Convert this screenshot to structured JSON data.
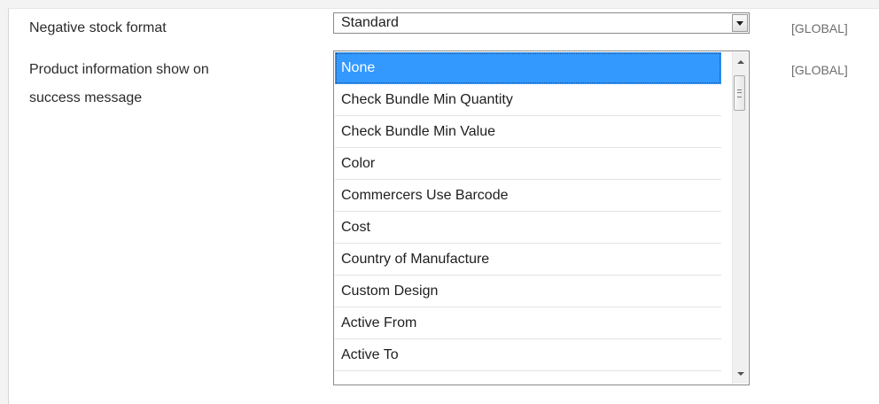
{
  "negative_stock": {
    "label": "Negative stock format",
    "value": "Standard",
    "scope": "[GLOBAL]"
  },
  "product_info": {
    "label_line1": "Product information show on",
    "label_line2": "success message",
    "scope": "[GLOBAL]",
    "selected": "None",
    "options": [
      "None",
      "Check Bundle Min Quantity",
      "Check Bundle Min Value",
      "Color",
      "Commercers Use Barcode",
      "Cost",
      "Country of Manufacture",
      "Custom Design",
      "Active From",
      "Active To"
    ]
  },
  "colors": {
    "selected_bg": "#3399ff",
    "scope_text": "#6d6d6d"
  },
  "icons": {
    "dropdown": "chevron-down-icon",
    "scroll_up": "scroll-up-arrow-icon",
    "scroll_down": "scroll-down-arrow-icon",
    "scroll_thumb_grip": "grip-icon"
  }
}
